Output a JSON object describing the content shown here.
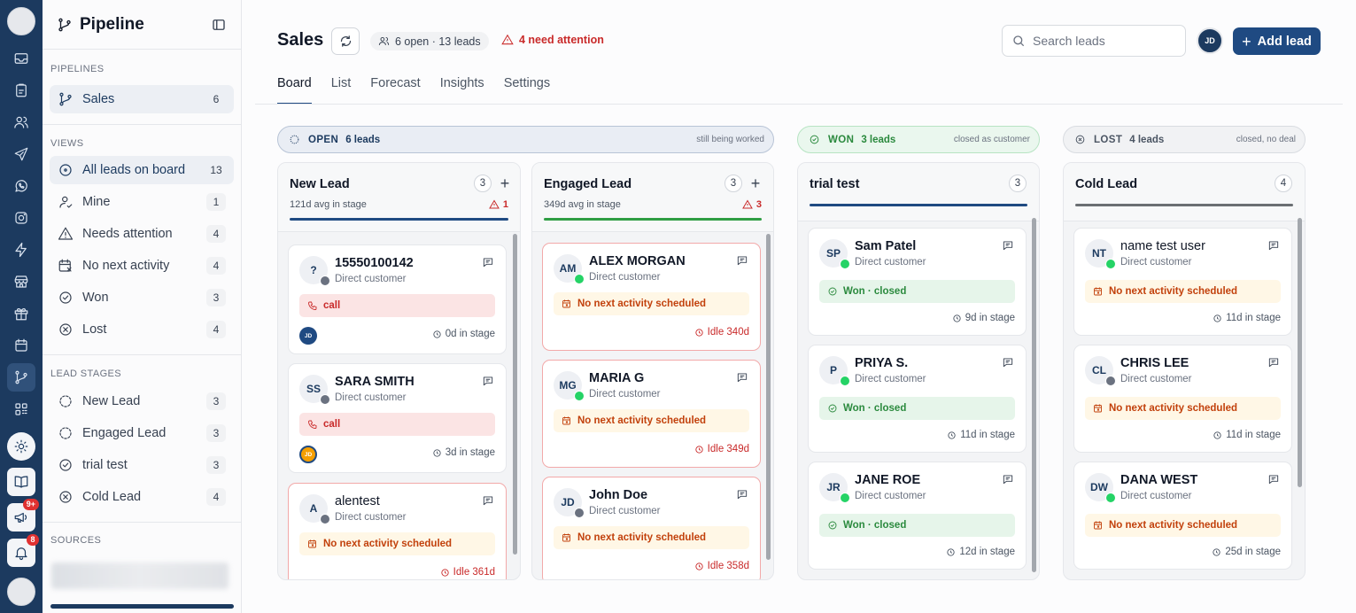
{
  "sidebar": {
    "title": "Pipeline",
    "sections": {
      "pipelines": "PIPELINES",
      "views": "VIEWS",
      "lead_stages": "LEAD STAGES",
      "sources": "SOURCES"
    },
    "pipelines": [
      {
        "label": "Sales",
        "count": "6",
        "icon": "branch-icon"
      }
    ],
    "views": [
      {
        "label": "All leads on board",
        "count": "13",
        "icon": "target-icon"
      },
      {
        "label": "Mine",
        "count": "1",
        "icon": "user-icon"
      },
      {
        "label": "Needs attention",
        "count": "4",
        "icon": "warning-icon"
      },
      {
        "label": "No next activity",
        "count": "4",
        "icon": "calendar-x-icon"
      },
      {
        "label": "Won",
        "count": "3",
        "icon": "check-circle-icon"
      },
      {
        "label": "Lost",
        "count": "4",
        "icon": "x-circle-icon"
      }
    ],
    "stages": [
      {
        "label": "New Lead",
        "count": "3",
        "icon": "dashed-circle-icon"
      },
      {
        "label": "Engaged Lead",
        "count": "3",
        "icon": "dashed-circle-icon"
      },
      {
        "label": "trial test",
        "count": "3",
        "icon": "check-circle-icon"
      },
      {
        "label": "Cold Lead",
        "count": "4",
        "icon": "x-circle-icon"
      }
    ]
  },
  "rail": {
    "badges": {
      "announcements": "9+",
      "notifications": "8"
    }
  },
  "header": {
    "title": "Sales",
    "open_summary": "6 open · 13 leads",
    "attention": "4 need attention",
    "search_placeholder": "Search leads",
    "avatar_initials": "JD",
    "add_lead_label": "Add lead"
  },
  "tabs": [
    "Board",
    "List",
    "Forecast",
    "Insights",
    "Settings"
  ],
  "groups": {
    "open": {
      "name": "OPEN",
      "count": "6 leads",
      "desc": "still being worked"
    },
    "won": {
      "name": "WON",
      "count": "3 leads",
      "desc": "closed as customer"
    },
    "lost": {
      "name": "LOST",
      "count": "4 leads",
      "desc": "closed, no deal"
    }
  },
  "columns": [
    {
      "name": "New Lead",
      "count": "3",
      "avg": "121d avg in stage",
      "warn": "1",
      "bar_color": "#1f4a82",
      "cards": [
        {
          "initials": "?",
          "name": "15550100142",
          "sub": "Direct customer",
          "chip": "call",
          "chip_type": "call",
          "foot": "0d in stage",
          "owner": "JD",
          "owner_color": "#1f4a82"
        },
        {
          "initials": "SS",
          "name": "SARA SMITH",
          "sub": "Direct customer",
          "chip": "call",
          "chip_type": "call",
          "foot": "3d in stage",
          "owner": "JD",
          "owner_color": "#f59f00"
        },
        {
          "initials": "A",
          "name": "alentest",
          "sub": "Direct customer",
          "chip": "No next activity scheduled",
          "chip_type": "noact",
          "foot": "Idle 361d"
        }
      ]
    },
    {
      "name": "Engaged Lead",
      "count": "3",
      "avg": "349d avg in stage",
      "warn": "3",
      "bar_color": "#2f9e44",
      "cards": [
        {
          "initials": "AM",
          "name": "ALEX MORGAN",
          "sub": "Direct customer",
          "chip": "No next activity scheduled",
          "chip_type": "noact",
          "foot": "Idle 340d"
        },
        {
          "initials": "MG",
          "name": "MARIA G",
          "sub": "Direct customer",
          "chip": "No next activity scheduled",
          "chip_type": "noact",
          "foot": "Idle 349d"
        },
        {
          "initials": "JD",
          "name": "John Doe",
          "sub": "Direct customer",
          "chip": "No next activity scheduled",
          "chip_type": "noact",
          "foot": "Idle 358d"
        }
      ]
    },
    {
      "name": "trial test",
      "count": "3",
      "bar_color": "#1f4a82",
      "cards": [
        {
          "initials": "SP",
          "name": "Sam Patel",
          "sub": "Direct customer",
          "chip": "Won · closed",
          "chip_type": "won",
          "foot": "9d in stage"
        },
        {
          "initials": "P",
          "name": "PRIYA S.",
          "sub": "Direct customer",
          "chip": "Won · closed",
          "chip_type": "won",
          "foot": "11d in stage"
        },
        {
          "initials": "JR",
          "name": "JANE ROE",
          "sub": "Direct customer",
          "chip": "Won · closed",
          "chip_type": "won",
          "foot": "12d in stage"
        }
      ]
    },
    {
      "name": "Cold Lead",
      "count": "4",
      "bar_color": "#6b6f73",
      "cards": [
        {
          "initials": "NT",
          "name": "name test user",
          "sub": "Direct customer",
          "chip": "No next activity scheduled",
          "chip_type": "noact",
          "foot": "11d in stage"
        },
        {
          "initials": "CL",
          "name": "CHRIS LEE",
          "sub": "Direct customer",
          "chip": "No next activity scheduled",
          "chip_type": "noact",
          "foot": "11d in stage"
        },
        {
          "initials": "DW",
          "name": "DANA WEST",
          "sub": "Direct customer",
          "chip": "No next activity scheduled",
          "chip_type": "noact",
          "foot": "25d in stage"
        }
      ]
    }
  ]
}
